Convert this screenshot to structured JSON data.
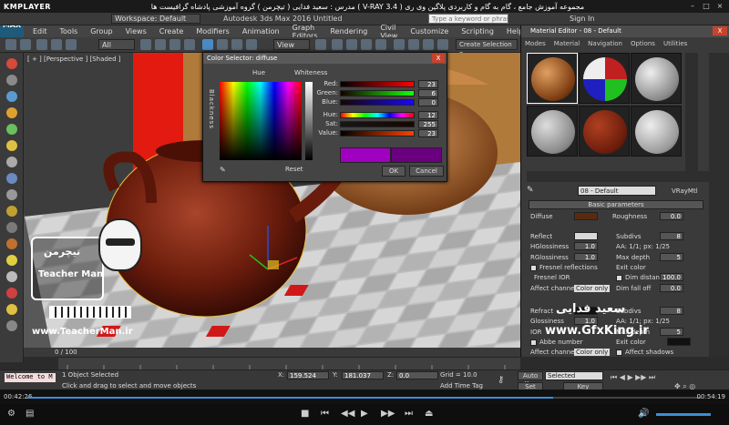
{
  "player": {
    "logo": "KMPLAYER",
    "title": "مجموعه آموزش جامع ، گام به گام و کاربردی پلاگین وی ری ( V-RAY 3.4 ) مدرس : سعید فدایی ( تیچرمن ) گروه آموزشی پادشاه گرافیست ها"
  },
  "max": {
    "logo": "MAX",
    "workspace": "Workspace: Default",
    "title": "Autodesk 3ds Max 2016    Untitled",
    "search_placeholder": "Type a keyword or phrase",
    "signin": "Sign In",
    "menus": [
      "Edit",
      "Tools",
      "Group",
      "Views",
      "Create",
      "Modifiers",
      "Animation",
      "Graph Editors",
      "Rendering",
      "Civil View",
      "Customize",
      "Scripting",
      "Help"
    ],
    "toolbar": {
      "filter": "All",
      "ref_coord": "View",
      "selection_set": "Create Selection Se"
    },
    "viewport_label": "[ + ] [Perspective ] [Shaded ]"
  },
  "color_selector": {
    "title": "Color Selector: diffuse",
    "close": "X",
    "hue_label": "Hue",
    "whiteness_label": "Whiteness",
    "blackness_label": "Blackness",
    "reset": "Reset",
    "ok": "OK",
    "cancel": "Cancel",
    "rows": [
      {
        "label": "Red:",
        "value": "23",
        "color": "#8b2a10"
      },
      {
        "label": "Green:",
        "value": "6",
        "color": "#3d7a1a"
      },
      {
        "label": "Blue:",
        "value": "0",
        "color": "#2a2a8b"
      },
      {
        "label": "Hue:",
        "value": "12",
        "color": "#c0a020"
      },
      {
        "label": "Sat:",
        "value": "255",
        "color": "#a04020"
      },
      {
        "label": "Value:",
        "value": "23",
        "color": "#4a2510"
      }
    ]
  },
  "material_editor": {
    "title": "Material Editor - 08 - Default",
    "close": "X",
    "menus": [
      "Modes",
      "Material",
      "Navigation",
      "Options",
      "Utilities"
    ],
    "material_name": "08 - Default",
    "material_type": "VRayMtl",
    "rollout": "Basic parameters",
    "diffuse_label": "Diffuse",
    "roughness_label": "Roughness",
    "roughness_value": "0.0",
    "reflect_label": "Reflect",
    "subdivs_label": "Subdivs",
    "subdivs_value": "8",
    "hglossiness_label": "HGlossiness",
    "hglossiness_value": "1.0",
    "aa_label": "AA: 1/1; px: 1/25",
    "rglossiness_label": "RGlossiness",
    "rglossiness_value": "1.0",
    "maxdepth_label": "Max depth",
    "maxdepth_value": "5",
    "fresnel_label": "Fresnel reflections",
    "exitcolor_label": "Exit color",
    "fresnel_ior_label": "Fresnel IOR",
    "dim_distance_label": "Dim distance",
    "dim_distance_value": "100.0",
    "affect_channels_label": "Affect channels",
    "affect_channels_value": "Color only",
    "dim_falloff_label": "Dim fall off",
    "dim_falloff_value": "0.0",
    "refract_label": "Refract",
    "subdivs2_label": "Subdivs",
    "subdivs2_value": "8",
    "glossiness_label": "Glossiness",
    "glossiness_value": "1.0",
    "aa2_label": "AA: 1/1; px: 1/25",
    "maxdepth2_label": "Max depth",
    "maxdepth2_value": "5",
    "ior_label": "IOR",
    "exitcolor2_label": "Exit color",
    "abbe_label": "Abbe number",
    "affect_shadows_label": "Affect shadows",
    "affect_channels2_label": "Affect channels",
    "affect_channels2_value": "Color only"
  },
  "watermarks": {
    "fadaei": "سعید فدایی",
    "gfxking": "www.GfxKing.ir",
    "teacher_url": "www.TeacherMan.ir",
    "teacher_logo": "Teacher Man",
    "teacher_logo_fa": "تیچرمن"
  },
  "timeline": {
    "frame": "0 / 100"
  },
  "status": {
    "welcome": "Welcome to M",
    "selected": "1 Object Selected",
    "hint": "Click and drag to select and move objects",
    "x_label": "X:",
    "x_value": "159.524",
    "y_label": "Y:",
    "y_value": "181.037",
    "z_label": "Z:",
    "z_value": "0.0",
    "grid": "Grid = 10.0",
    "add_time_tag": "Add Time Tag",
    "auto_key": "Auto Key",
    "set_key": "Set Key",
    "selected_dd": "Selected",
    "key_filters": "Key Filters..."
  },
  "playback": {
    "current_time": "00:42:26",
    "total_time": "00:54:19",
    "progress": 0.78
  },
  "colors": {
    "accent": "#3a8fd9",
    "wood": "#7a2a10",
    "diffuse_swatch": "#5a2a10",
    "new_color": "#a000c0"
  }
}
